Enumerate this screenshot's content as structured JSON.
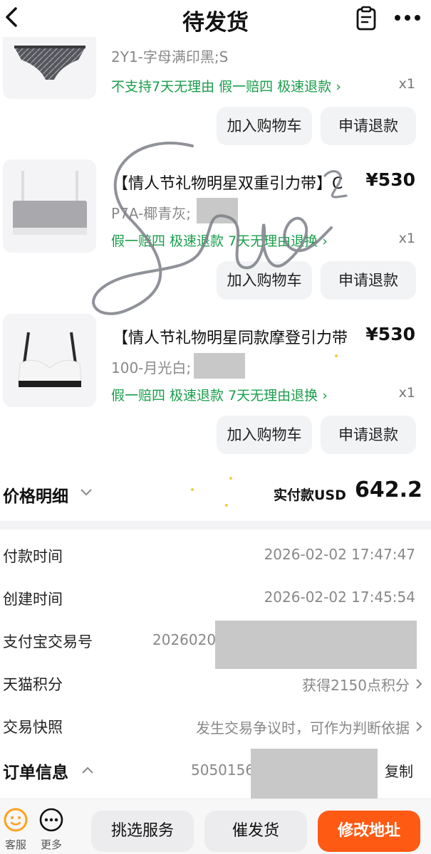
{
  "header": {
    "title": "待发货",
    "back_icon": "back-arrow-icon",
    "note_icon": "clipboard-icon",
    "more_icon": "more-dots-icon"
  },
  "items": [
    {
      "sku": "2Y1-字母满印黑;S",
      "tags": "不支持7天无理由   假一赔四   极速退款 ›",
      "qty": "x1",
      "add_cart": "加入购物车",
      "refund": "申请退款"
    },
    {
      "name": "【情人节礼物明星双重引力带】C",
      "price": "¥530",
      "sku": "P7A-椰青灰;",
      "tags": "假一赔四   极速退款   7天无理由退换 ›",
      "qty": "x1",
      "add_cart": "加入购物车",
      "refund": "申请退款"
    },
    {
      "name": "【情人节礼物明星同款摩登引力带",
      "price": "¥530",
      "sku": "100-月光白;",
      "tags": "假一赔四   极速退款   7天无理由退换 ›",
      "qty": "x1",
      "add_cart": "加入购物车",
      "refund": "申请退款"
    }
  ],
  "price_detail": {
    "label": "价格明细",
    "paid_label": "实付款USD",
    "paid_amount": "642.2"
  },
  "info": {
    "pay_time_label": "付款时间",
    "pay_time": "2026-02-02 17:47:47",
    "create_time_label": "创建时间",
    "create_time": "2026-02-02 17:45:54",
    "alipay_label": "支付宝交易号",
    "alipay_no": "2026020",
    "points_label": "天猫积分",
    "points": "获得2150点积分",
    "snapshot_label": "交易快照",
    "snapshot": "发生交易争议时，可作为判断依据"
  },
  "order": {
    "label": "订单信息",
    "number": "5050156",
    "copy": "复制"
  },
  "bottom": {
    "service_label": "客服",
    "more_label": "更多",
    "select_service": "挑选服务",
    "urge_ship": "催发货",
    "modify_address": "修改地址"
  },
  "colors": {
    "green_tag": "#1a9e4b",
    "orange": "#ff5a14",
    "service_icon": "#ffa21d"
  }
}
